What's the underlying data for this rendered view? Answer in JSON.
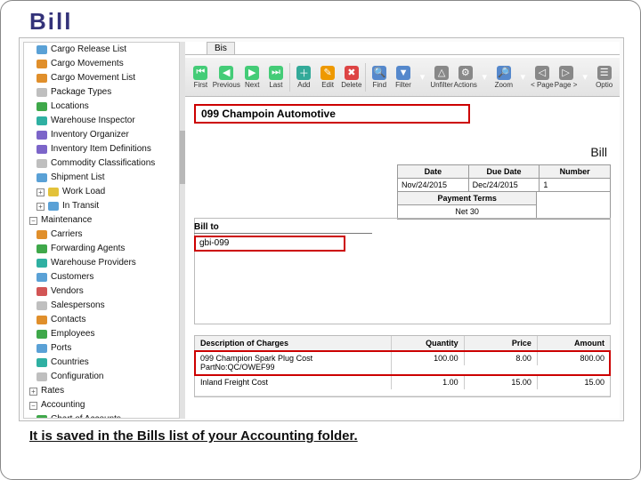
{
  "title": "Bill",
  "caption": "It is saved in the Bills list of your Accounting folder.",
  "tree": {
    "items": [
      {
        "label": "Cargo Release List",
        "cls": "c-blue"
      },
      {
        "label": "Cargo Movements",
        "cls": "c-orange"
      },
      {
        "label": "Cargo Movement List",
        "cls": "c-orange"
      },
      {
        "label": "Package Types",
        "cls": "c-gray"
      },
      {
        "label": "Locations",
        "cls": "c-green"
      },
      {
        "label": "Warehouse Inspector",
        "cls": "c-teal"
      },
      {
        "label": "Inventory Organizer",
        "cls": "c-purple"
      },
      {
        "label": "Inventory Item Definitions",
        "cls": "c-purple"
      },
      {
        "label": "Commodity Classifications",
        "cls": "c-gray"
      },
      {
        "label": "Shipment List",
        "cls": "c-blue"
      },
      {
        "label": "Work Load",
        "cls": "c-yel",
        "pm": "+"
      },
      {
        "label": "In Transit",
        "cls": "c-blue",
        "pm": "+"
      }
    ],
    "maint_label": "Maintenance",
    "maint": [
      {
        "label": "Carriers",
        "cls": "c-orange"
      },
      {
        "label": "Forwarding Agents",
        "cls": "c-green"
      },
      {
        "label": "Warehouse Providers",
        "cls": "c-teal"
      },
      {
        "label": "Customers",
        "cls": "c-blue"
      },
      {
        "label": "Vendors",
        "cls": "c-red"
      },
      {
        "label": "Salespersons",
        "cls": "c-gray"
      },
      {
        "label": "Contacts",
        "cls": "c-orange"
      },
      {
        "label": "Employees",
        "cls": "c-green"
      },
      {
        "label": "Ports",
        "cls": "c-blue"
      },
      {
        "label": "Countries",
        "cls": "c-teal"
      },
      {
        "label": "Configuration",
        "cls": "c-gray"
      }
    ],
    "rates_label": "Rates",
    "acct_label": "Accounting",
    "acct": [
      {
        "label": "Chart of Accounts",
        "cls": "c-green"
      }
    ]
  },
  "tab": "Bis",
  "toolbar": [
    {
      "label": "First",
      "name": "first",
      "icon": "⏮",
      "color": "#4c7"
    },
    {
      "label": "Previous",
      "name": "prev",
      "icon": "◀",
      "color": "#4c7"
    },
    {
      "label": "Next",
      "name": "next",
      "icon": "▶",
      "color": "#4c7"
    },
    {
      "label": "Last",
      "name": "last",
      "icon": "⏭",
      "color": "#4c7"
    },
    {
      "label": "",
      "name": "sep1"
    },
    {
      "label": "Add",
      "name": "add",
      "icon": "＋",
      "color": "#3a9"
    },
    {
      "label": "Edit",
      "name": "edit",
      "icon": "✎",
      "color": "#e90"
    },
    {
      "label": "Delete",
      "name": "delete",
      "icon": "✖",
      "color": "#d44"
    },
    {
      "label": "",
      "name": "sep2"
    },
    {
      "label": "Find",
      "name": "find",
      "icon": "🔍",
      "color": "#58c"
    },
    {
      "label": "Filter",
      "name": "filter",
      "icon": "▼",
      "color": "#58c"
    },
    {
      "label": "",
      "name": "dd1",
      "icon": "▾",
      "narrow": true
    },
    {
      "label": "Unfilter",
      "name": "unfilter",
      "icon": "△",
      "color": "#888"
    },
    {
      "label": "Actions",
      "name": "actions",
      "icon": "⚙",
      "color": "#888"
    },
    {
      "label": "",
      "name": "dd2",
      "icon": "▾",
      "narrow": true
    },
    {
      "label": "Zoom",
      "name": "zoom",
      "icon": "🔎",
      "color": "#58c"
    },
    {
      "label": "",
      "name": "dd3",
      "icon": "▾",
      "narrow": true
    },
    {
      "label": "< Page",
      "name": "pageprev",
      "icon": "◁",
      "color": "#888"
    },
    {
      "label": "Page >",
      "name": "pagenext",
      "icon": "▷",
      "color": "#888"
    },
    {
      "label": "",
      "name": "dd4",
      "icon": "▾",
      "narrow": true
    },
    {
      "label": "Optio",
      "name": "options",
      "icon": "☰",
      "color": "#888"
    }
  ],
  "header": "099 Champoin Automotive",
  "doc_title": "Bill",
  "meta": {
    "date_h": "Date",
    "due_h": "Due Date",
    "num_h": "Number",
    "date": "Nov/24/2015",
    "due": "Dec/24/2015",
    "num": "1",
    "terms_h": "Payment Terms",
    "terms": "Net 30"
  },
  "billto": {
    "label": "Bill to",
    "value": "gbi-099"
  },
  "charges": {
    "h_desc": "Description of Charges",
    "h_qty": "Quantity",
    "h_price": "Price",
    "h_amt": "Amount",
    "rows": [
      {
        "desc": "099 Champion Spark Plug Cost",
        "desc2": "PartNo:QC/OWEF99",
        "qty": "100.00",
        "price": "8.00",
        "amt": "800.00"
      },
      {
        "desc": "Inland Freight Cost",
        "desc2": "",
        "qty": "1.00",
        "price": "15.00",
        "amt": "15.00"
      }
    ]
  }
}
